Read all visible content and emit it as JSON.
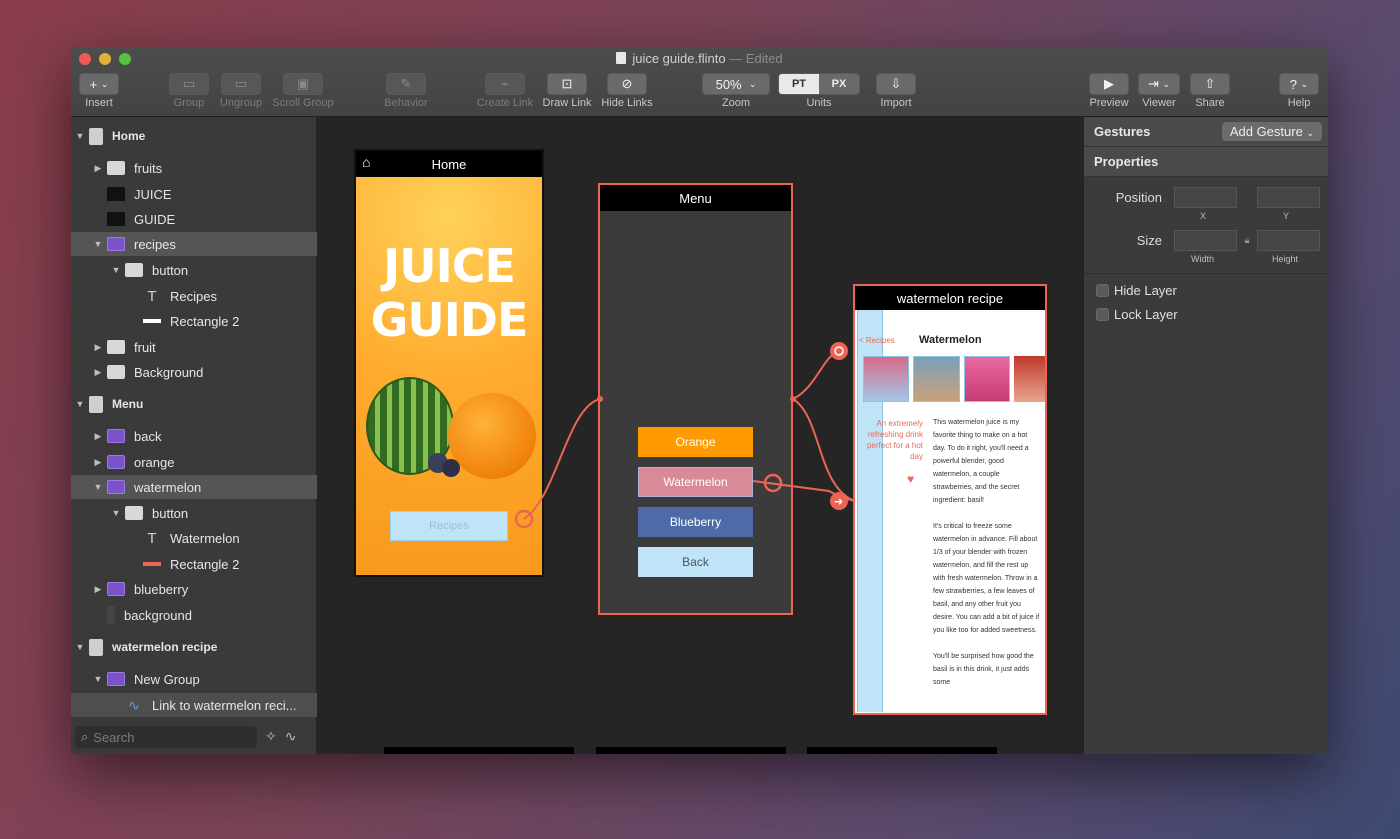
{
  "window": {
    "filename": "juice guide.flinto",
    "edited": "— Edited"
  },
  "toolbar": {
    "insert": "Insert",
    "insert_btn": "+",
    "group": "Group",
    "ungroup": "Ungroup",
    "scroll_group": "Scroll Group",
    "behavior": "Behavior",
    "create_link": "Create Link",
    "draw_link": "Draw Link",
    "hide_links": "Hide Links",
    "zoom_value": "50%",
    "zoom": "Zoom",
    "units_pt": "PT",
    "units_px": "PX",
    "units": "Units",
    "import": "Import",
    "preview": "Preview",
    "viewer": "Viewer",
    "share": "Share",
    "help": "Help"
  },
  "layers": [
    {
      "label": "Home",
      "type": "screen",
      "indent": 0,
      "arrow": "▼",
      "bold": true
    },
    {
      "label": "fruits",
      "type": "folder",
      "indent": 1,
      "arrow": "▶"
    },
    {
      "label": "JUICE",
      "type": "img",
      "indent": 1,
      "arrow": ""
    },
    {
      "label": "GUIDE",
      "type": "img",
      "indent": 1,
      "arrow": ""
    },
    {
      "label": "recipes",
      "type": "group",
      "indent": 1,
      "arrow": "▼",
      "selected": true
    },
    {
      "label": "button",
      "type": "folder",
      "indent": 2,
      "arrow": "▼"
    },
    {
      "label": "Recipes",
      "type": "text",
      "indent": 3,
      "arrow": ""
    },
    {
      "label": "Rectangle 2",
      "type": "rect-w",
      "indent": 3,
      "arrow": ""
    },
    {
      "label": "fruit",
      "type": "folder",
      "indent": 1,
      "arrow": "▶"
    },
    {
      "label": "Background",
      "type": "folder",
      "indent": 1,
      "arrow": "▶"
    },
    {
      "label": "Menu",
      "type": "screen",
      "indent": 0,
      "arrow": "▼",
      "bold": true
    },
    {
      "label": "back",
      "type": "group",
      "indent": 1,
      "arrow": "▶"
    },
    {
      "label": "orange",
      "type": "group",
      "indent": 1,
      "arrow": "▶"
    },
    {
      "label": "watermelon",
      "type": "group",
      "indent": 1,
      "arrow": "▼",
      "selected": true
    },
    {
      "label": "button",
      "type": "folder",
      "indent": 2,
      "arrow": "▼"
    },
    {
      "label": "Watermelon",
      "type": "text",
      "indent": 3,
      "arrow": ""
    },
    {
      "label": "Rectangle 2",
      "type": "rect-r",
      "indent": 3,
      "arrow": ""
    },
    {
      "label": "blueberry",
      "type": "group",
      "indent": 1,
      "arrow": "▶"
    },
    {
      "label": "background",
      "type": "bg",
      "indent": 1,
      "arrow": ""
    },
    {
      "label": "watermelon recipe",
      "type": "screen",
      "indent": 0,
      "arrow": "▼",
      "bold": true
    },
    {
      "label": "New Group",
      "type": "group",
      "indent": 1,
      "arrow": "▼"
    },
    {
      "label": "Link to watermelon reci...",
      "type": "link",
      "indent": 2,
      "arrow": "",
      "selected2": true
    }
  ],
  "search": {
    "placeholder": "Search"
  },
  "inspector": {
    "gestures": "Gestures",
    "add_gesture": "Add Gesture",
    "properties": "Properties",
    "position": "Position",
    "x": "X",
    "y": "Y",
    "size": "Size",
    "width": "Width",
    "height": "Height",
    "hide_layer": "Hide Layer",
    "lock_layer": "Lock Layer"
  },
  "screens": {
    "home": {
      "title": "Home",
      "juice": "JUICE",
      "guide": "GUIDE",
      "button": "Recipes"
    },
    "menu": {
      "title": "Menu",
      "buttons": [
        "Orange",
        "Watermelon",
        "Blueberry",
        "Back"
      ]
    },
    "recipe": {
      "title": "watermelon recipe",
      "back": "< Recipes",
      "heading": "Watermelon",
      "quote": "An extremely refreshing drink perfect for a hot day",
      "body1": "This watermelon juice is my favorite thing to make on a hot day. To do it right, you'll need a powerful blender, good watermelon, a couple strawberries, and the secret ingredient: basil!",
      "body2": "It's critical to freeze some watermelon in advance. Fill about 1/3 of your blender with frozen watermelon, and fill the rest up with fresh watermelon. Throw in a few strawberries, a few leaves of basil, and any other fruit you desire. You can add a bit of juice if you like too for added sweetness.",
      "body3": "You'll be surprised how good the basil is in this drink, it just adds some"
    }
  },
  "colors": {
    "accent": "#ec6454",
    "orange_btn": "#ff9a00",
    "watermelon_btn": "#d98a99",
    "blueberry_btn": "#4e6aa8",
    "back_btn": "#bfe3f7"
  }
}
